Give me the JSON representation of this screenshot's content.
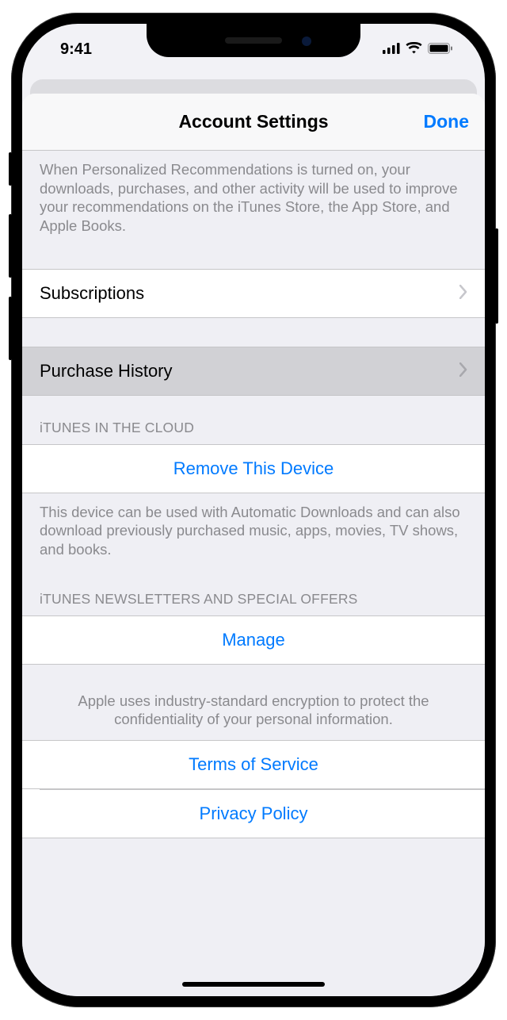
{
  "status": {
    "time": "9:41"
  },
  "nav": {
    "title": "Account Settings",
    "done": "Done"
  },
  "recommendations_footer": "When Personalized Recommendations is turned on, your downloads, purchases, and other activity will be used to improve your recommendations on the iTunes Store, the App Store, and Apple Books.",
  "subscriptions": {
    "label": "Subscriptions"
  },
  "purchase_history": {
    "label": "Purchase History"
  },
  "itunes_cloud": {
    "header": "iTUNES IN THE CLOUD",
    "remove": "Remove This Device",
    "footer": "This device can be used with Automatic Downloads and can also download previously purchased music, apps, movies, TV shows, and books."
  },
  "newsletters": {
    "header": "iTUNES NEWSLETTERS AND SPECIAL OFFERS",
    "manage": "Manage"
  },
  "encryption_footer": "Apple uses industry-standard encryption to protect the confidentiality of your personal information.",
  "links": {
    "terms": "Terms of Service",
    "privacy": "Privacy Policy"
  }
}
